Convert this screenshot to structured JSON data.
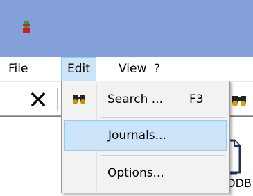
{
  "titlebar": {
    "icon": "app-icon-red-green",
    "color": "#83a0d8"
  },
  "menubar": {
    "items": [
      {
        "label": "File"
      },
      {
        "label": "Edit"
      },
      {
        "label": "View"
      },
      {
        "label": "?"
      }
    ],
    "active_index": 1
  },
  "toolbar": {
    "buttons": [
      {
        "icon": "close-icon"
      },
      {
        "icon": "binoculars-icon"
      }
    ]
  },
  "content": {
    "file_item": {
      "icon": "file-icon",
      "label": "ODB"
    }
  },
  "edit_menu": {
    "items": [
      {
        "label": "Search ...",
        "shortcut": "F3",
        "icon": "binoculars-icon"
      },
      {
        "label": "Journals..."
      },
      {
        "label": "Options..."
      }
    ],
    "highlighted_index": 1
  },
  "colors": {
    "highlight_bg": "#cce4f7",
    "highlight_border": "#99c9ef",
    "menu_bg": "#f2f2f2"
  }
}
